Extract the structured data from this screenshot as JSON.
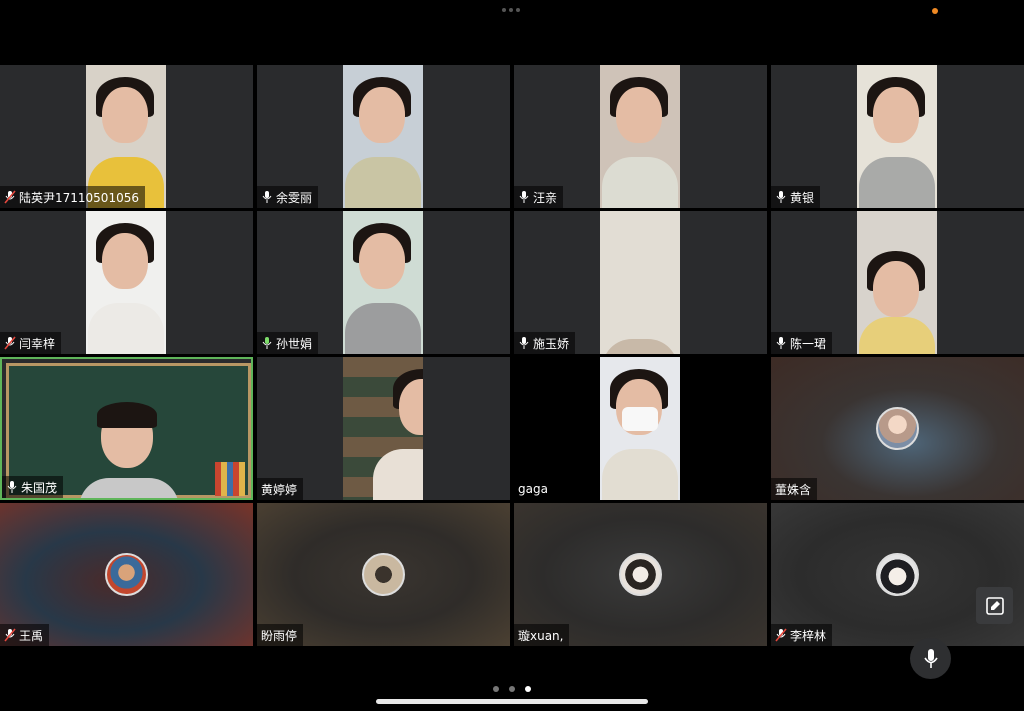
{
  "participants": [
    {
      "name": "陆英尹17110501056",
      "muted": true
    },
    {
      "name": "余雯丽",
      "muted": false
    },
    {
      "name": "汪亲",
      "muted": false
    },
    {
      "name": "黄银",
      "muted": false
    },
    {
      "name": "闫幸梓",
      "muted": true
    },
    {
      "name": "孙世娟",
      "muted": false
    },
    {
      "name": "施玉娇",
      "muted": false
    },
    {
      "name": "陈一珺",
      "muted": false
    },
    {
      "name": "朱国茂",
      "muted": false
    },
    {
      "name": "黄婷婷",
      "muted": null
    },
    {
      "name": "gaga",
      "muted": null
    },
    {
      "name": "董姝含",
      "muted": null
    },
    {
      "name": "王禹",
      "muted": true
    },
    {
      "name": "盼雨停",
      "muted": null
    },
    {
      "name": "璇xuan,",
      "muted": null
    },
    {
      "name": "李梓林",
      "muted": true
    }
  ],
  "page_indicator": {
    "total": 3,
    "current": 3
  },
  "colors": {
    "active_speaker_border": "#5fb55a",
    "status_dot": "#f08a24",
    "tile_bg": "#2a2b2d"
  },
  "icons": {
    "mic": "mic-icon",
    "mic_muted": "mic-muted-icon",
    "edit": "edit-icon",
    "mic_button": "microphone-icon"
  }
}
